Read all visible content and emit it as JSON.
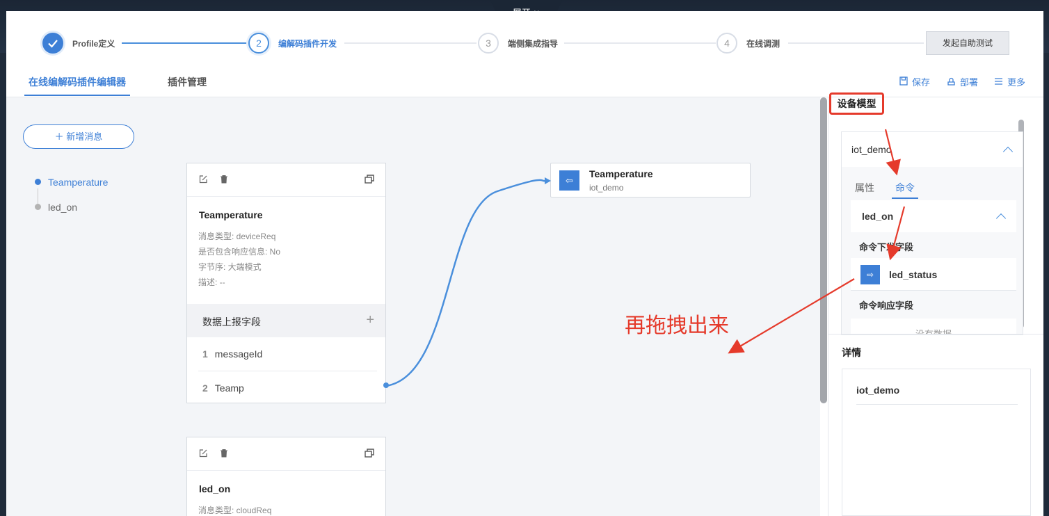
{
  "topbar": {
    "expand_label": "展开"
  },
  "steps": [
    {
      "number": "1",
      "label": "Profile定义",
      "state": "done"
    },
    {
      "number": "2",
      "label": "编解码插件开发",
      "state": "active"
    },
    {
      "number": "3",
      "label": "端侧集成指导",
      "state": "pending"
    },
    {
      "number": "4",
      "label": "在线调测",
      "state": "pending"
    }
  ],
  "auto_test_label": "发起自助测试",
  "tabs": [
    {
      "label": "在线编解码插件编辑器",
      "active": true
    },
    {
      "label": "插件管理",
      "active": false
    }
  ],
  "toolbar": {
    "save": "保存",
    "deploy": "部署",
    "more": "更多"
  },
  "sidebar": {
    "add_message": "新增消息",
    "messages": [
      {
        "label": "Teamperature",
        "active": true
      },
      {
        "label": "led_on",
        "active": false
      }
    ]
  },
  "cards": [
    {
      "title": "Teamperature",
      "meta": [
        "消息类型: deviceReq",
        "是否包含响应信息: No",
        "字节序: 大端模式",
        "描述: --"
      ],
      "fields_header": "数据上报字段",
      "fields": [
        {
          "index": "1",
          "name": "messageId"
        },
        {
          "index": "2",
          "name": "Teamp"
        }
      ]
    },
    {
      "title": "led_on",
      "meta": [
        "消息类型: cloudReq"
      ]
    }
  ],
  "target": {
    "title": "Teamperature",
    "subtitle": "iot_demo"
  },
  "annotation": "再拖拽出来",
  "device_model": {
    "title": "设备模型",
    "product": "iot_demo",
    "subtabs": [
      {
        "label": "属性",
        "active": false
      },
      {
        "label": "命令",
        "active": true
      }
    ],
    "command": {
      "name": "led_on",
      "downlink_label": "命令下发字段",
      "downlink_field": "led_status",
      "response_label": "命令响应字段",
      "no_data": "没有数据"
    }
  },
  "details": {
    "title": "详情",
    "name": "iot_demo"
  },
  "colors": {
    "accent": "#3d7fd6",
    "annotation": "#e53a2b"
  }
}
